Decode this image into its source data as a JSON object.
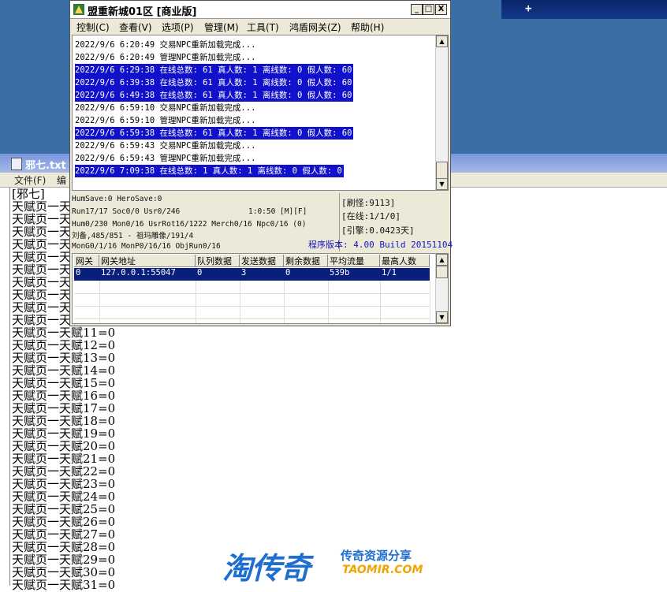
{
  "desktop": {
    "taskbar_glyph": "+"
  },
  "notepad": {
    "title": "邪七.txt",
    "menu": [
      "文件(F)",
      "编"
    ],
    "lines": [
      "[邪七]",
      "天赋页一天",
      "天赋页一天",
      "天赋页一天",
      "天赋页一天",
      "天赋页一天",
      "天赋页一天",
      "天赋页一天",
      "天赋页一天",
      "天赋页一天",
      "天赋页一天",
      "天赋页一天赋11=0",
      "天赋页一天赋12=0",
      "天赋页一天赋13=0",
      "天赋页一天赋14=0",
      "天赋页一天赋15=0",
      "天赋页一天赋16=0",
      "天赋页一天赋17=0",
      "天赋页一天赋18=0",
      "天赋页一天赋19=0",
      "天赋页一天赋20=0",
      "天赋页一天赋21=0",
      "天赋页一天赋22=0",
      "天赋页一天赋23=0",
      "天赋页一天赋24=0",
      "天赋页一天赋25=0",
      "天赋页一天赋26=0",
      "天赋页一天赋27=0",
      "天赋页一天赋28=0",
      "天赋页一天赋29=0",
      "天赋页一天赋30=0",
      "天赋页一天赋31=0"
    ]
  },
  "window": {
    "title": "盟重新城01区 [商业版]",
    "buttons": {
      "minimize": "_",
      "maximize": "□",
      "close": "X"
    },
    "menu": [
      "控制(C)",
      "查看(V)",
      "选项(P)",
      "管理(M)",
      "工具(T)",
      "鸿盾网关(Z)",
      "帮助(H)"
    ]
  },
  "log": [
    {
      "text": "2022/9/6 6:20:49 交易NPC重新加载完成...",
      "highlight": false
    },
    {
      "text": "2022/9/6 6:20:49 管理NPC重新加载完成...",
      "highlight": false
    },
    {
      "text": "2022/9/6 6:29:38 在线总数: 61 真人数: 1 离线数: 0 假人数: 60",
      "highlight": true
    },
    {
      "text": "2022/9/6 6:39:38 在线总数: 61 真人数: 1 离线数: 0 假人数: 60",
      "highlight": true
    },
    {
      "text": "2022/9/6 6:49:38 在线总数: 61 真人数: 1 离线数: 0 假人数: 60",
      "highlight": true
    },
    {
      "text": "2022/9/6 6:59:10 交易NPC重新加载完成...",
      "highlight": false
    },
    {
      "text": "2022/9/6 6:59:10 管理NPC重新加载完成...",
      "highlight": false
    },
    {
      "text": "2022/9/6 6:59:38 在线总数: 61 真人数: 1 离线数: 0 假人数: 60",
      "highlight": true
    },
    {
      "text": "2022/9/6 6:59:43 交易NPC重新加载完成...",
      "highlight": false
    },
    {
      "text": "2022/9/6 6:59:43 管理NPC重新加载完成...",
      "highlight": false
    },
    {
      "text": "2022/9/6 7:09:38 在线总数: 1 真人数: 1 离线数: 0 假人数: 0",
      "highlight": true
    }
  ],
  "status": {
    "line1": "HumSave:0 HeroSave:0",
    "line2a": "Run17/17 Soc0/0 Usr0/246",
    "line2b": "1:0:50 [M][F]",
    "line3": "Hum0/230 Mon0/16 UsrRot16/1222 Merch0/16 Npc0/16 (0)",
    "line4": "刘备,485/851 - 祖玛雕像/191/4",
    "line5": "MonG0/1/16 MonP0/16/16 ObjRun0/16",
    "refresh": "[刷怪:9113]",
    "online": "[在线:1/1/0]",
    "engine": "[引擎:0.0423天]",
    "version": "程序版本: 4.00 Build 20151104"
  },
  "gateway_table": {
    "headers": [
      "网关",
      "网关地址",
      "队列数据",
      "发送数据",
      "剩余数据",
      "平均流量",
      "最高人数"
    ],
    "rows": [
      [
        "0",
        "127.0.0.1:55047",
        "0",
        "3",
        "0",
        "539b",
        "1/1"
      ]
    ]
  },
  "watermark": {
    "big": "淘传奇",
    "small": "传奇资源分享",
    "url": "TAOMIR.COM"
  }
}
